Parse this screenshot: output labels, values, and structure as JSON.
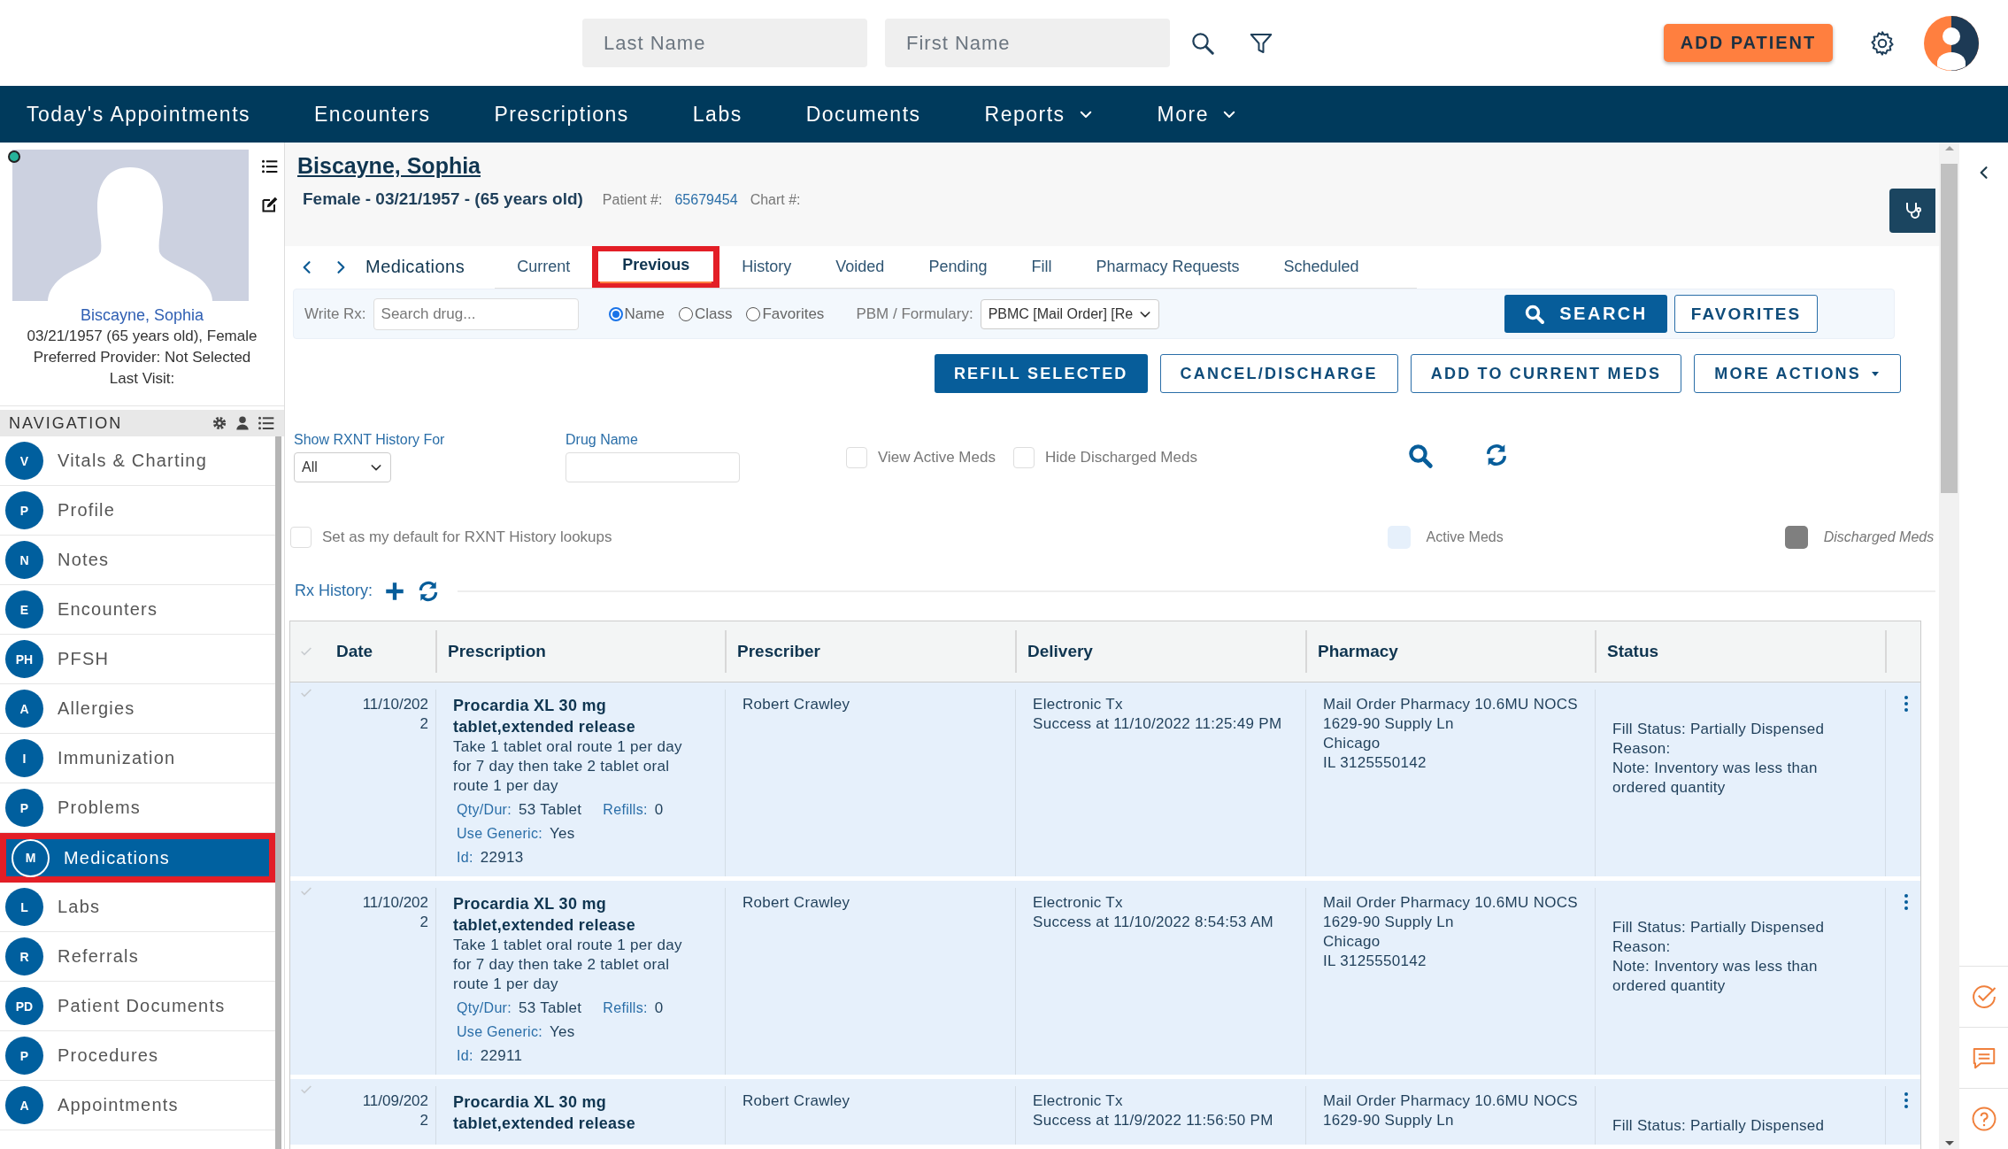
{
  "topbar": {
    "last_name": {
      "placeholder": "Last Name"
    },
    "first_name": {
      "placeholder": "First Name"
    },
    "add_button": "ADD PATIENT"
  },
  "nav": [
    {
      "label": "Today's Appointments",
      "dropdown": false
    },
    {
      "label": "Encounters",
      "dropdown": false
    },
    {
      "label": "Prescriptions",
      "dropdown": false
    },
    {
      "label": "Labs",
      "dropdown": false
    },
    {
      "label": "Documents",
      "dropdown": false
    },
    {
      "label": "Reports",
      "dropdown": true
    },
    {
      "label": "More",
      "dropdown": true
    }
  ],
  "patient_card": {
    "name": "Biscayne, Sophia",
    "lines": [
      "03/21/1957 (65 years old), Female",
      "Preferred Provider: Not Selected",
      "Last Visit:"
    ]
  },
  "navigation": {
    "title": "NAVIGATION",
    "items": [
      {
        "badge": "V",
        "label": "Vitals & Charting",
        "selected": false,
        "highlighted": false
      },
      {
        "badge": "P",
        "label": "Profile",
        "selected": false,
        "highlighted": false
      },
      {
        "badge": "N",
        "label": "Notes",
        "selected": false,
        "highlighted": false
      },
      {
        "badge": "E",
        "label": "Encounters",
        "selected": false,
        "highlighted": false
      },
      {
        "badge": "PH",
        "label": "PFSH",
        "selected": false,
        "highlighted": false
      },
      {
        "badge": "A",
        "label": "Allergies",
        "selected": false,
        "highlighted": false
      },
      {
        "badge": "I",
        "label": "Immunization",
        "selected": false,
        "highlighted": false
      },
      {
        "badge": "P",
        "label": "Problems",
        "selected": false,
        "highlighted": false
      },
      {
        "badge": "M",
        "label": "Medications",
        "selected": true,
        "highlighted": true
      },
      {
        "badge": "L",
        "label": "Labs",
        "selected": false,
        "highlighted": false
      },
      {
        "badge": "R",
        "label": "Referrals",
        "selected": false,
        "highlighted": false
      },
      {
        "badge": "PD",
        "label": "Patient Documents",
        "selected": false,
        "highlighted": false
      },
      {
        "badge": "P",
        "label": "Procedures",
        "selected": false,
        "highlighted": false
      },
      {
        "badge": "A",
        "label": "Appointments",
        "selected": false,
        "highlighted": false
      }
    ]
  },
  "header": {
    "name": "Biscayne, Sophia",
    "summary": "Female - 03/21/1957 - (65 years old)",
    "patient_label": "Patient #:",
    "patient_number": "65679454",
    "chart_label": "Chart #:"
  },
  "section_title": "Medications",
  "tabs": [
    {
      "label": "Current",
      "selected": false,
      "highlighted": false
    },
    {
      "label": "Previous",
      "selected": true,
      "highlighted": true
    },
    {
      "label": "History",
      "selected": false,
      "highlighted": false
    },
    {
      "label": "Voided",
      "selected": false,
      "highlighted": false
    },
    {
      "label": "Pending",
      "selected": false,
      "highlighted": false
    },
    {
      "label": "Fill",
      "selected": false,
      "highlighted": false
    },
    {
      "label": "Pharmacy Requests",
      "selected": false,
      "highlighted": false
    },
    {
      "label": "Scheduled",
      "selected": false,
      "highlighted": false
    }
  ],
  "write_rx": {
    "label": "Write Rx:",
    "search": {
      "placeholder": "Search drug..."
    },
    "modes": [
      {
        "label": "Name",
        "selected": true
      },
      {
        "label": "Class",
        "selected": false
      },
      {
        "label": "Favorites",
        "selected": false
      }
    ],
    "pbm_label": "PBM / Formulary:",
    "pbm_value": "PBMC [Mail Order] [Re",
    "search_button": "SEARCH",
    "favorites_button": "FAVORITES"
  },
  "actions": [
    {
      "label": "REFILL SELECTED",
      "kind": "primary"
    },
    {
      "label": "CANCEL/DISCHARGE",
      "kind": "outline"
    },
    {
      "label": "ADD TO CURRENT MEDS",
      "kind": "outline"
    },
    {
      "label": "MORE ACTIONS",
      "kind": "menu"
    }
  ],
  "filters": {
    "history_label": "Show RXNT History For",
    "history_value": "All",
    "drug_label": "Drug Name",
    "options": [
      {
        "label": "View Active Meds",
        "checked": false
      },
      {
        "label": "Hide Discharged Meds",
        "checked": false
      }
    ],
    "default_option": {
      "label": "Set as my default for RXNT History lookups",
      "checked": false
    },
    "legend": [
      {
        "label": "Active Meds",
        "color": "#e6f0fb"
      },
      {
        "label": "Discharged Meds",
        "color": "#7f7f7f"
      }
    ]
  },
  "rx_history": {
    "title": "Rx History:",
    "columns": [
      "Date",
      "Prescription",
      "Prescriber",
      "Delivery",
      "Pharmacy",
      "Status"
    ],
    "rows": [
      {
        "date": "11/10/2022",
        "drug": "Procardia XL 30 mg tablet,extended release",
        "sig": "Take 1 tablet oral route 1 per day for 7 day then take 2 tablet oral route 1 per day",
        "qty_label": "Qty/Dur:",
        "qty": "53 Tablet",
        "refills_label": "Refills:",
        "refills": "0",
        "generic_label": "Use Generic:",
        "generic": "Yes",
        "id_label": "Id:",
        "id": "22913",
        "prescriber": "Robert Crawley",
        "delivery": [
          "Electronic Tx",
          "Success at 11/10/2022 11:25:49 PM"
        ],
        "pharmacy": [
          "Mail Order Pharmacy 10.6MU NOCS",
          "1629-90 Supply Ln",
          "Chicago",
          "IL 3125550142"
        ],
        "status": [
          "Fill Status: Partially Dispensed",
          "Reason:",
          "Note: Inventory was less than ordered quantity"
        ]
      },
      {
        "date": "11/10/2022",
        "drug": "Procardia XL 30 mg tablet,extended release",
        "sig": "Take 1 tablet oral route 1 per day for 7 day then take 2 tablet oral route 1 per day",
        "qty_label": "Qty/Dur:",
        "qty": "53 Tablet",
        "refills_label": "Refills:",
        "refills": "0",
        "generic_label": "Use Generic:",
        "generic": "Yes",
        "id_label": "Id:",
        "id": "22911",
        "prescriber": "Robert Crawley",
        "delivery": [
          "Electronic Tx",
          "Success at 11/10/2022 8:54:53 AM"
        ],
        "pharmacy": [
          "Mail Order Pharmacy 10.6MU NOCS",
          "1629-90 Supply Ln",
          "Chicago",
          "IL 3125550142"
        ],
        "status": [
          "Fill Status: Partially Dispensed",
          "Reason:",
          "Note: Inventory was less than ordered quantity"
        ]
      },
      {
        "date": "11/09/2022",
        "drug": "Procardia XL 30 mg tablet,extended release",
        "prescriber": "Robert Crawley",
        "delivery": [
          "Electronic Tx",
          "Success at 11/9/2022 11:56:50 PM"
        ],
        "pharmacy": [
          "Mail Order Pharmacy 10.6MU NOCS",
          "1629-90 Supply Ln"
        ],
        "status": [
          "Fill Status: Partially Dispensed"
        ]
      }
    ]
  }
}
